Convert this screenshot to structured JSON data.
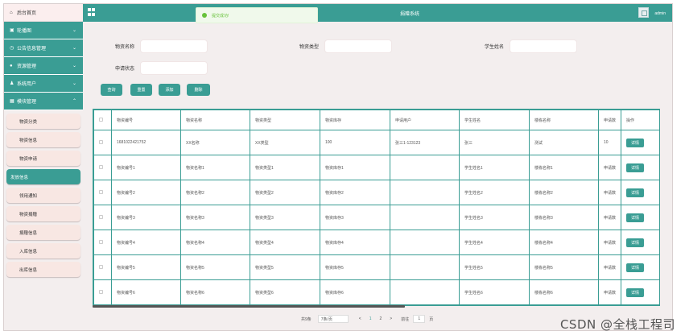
{
  "sidebar": {
    "home": "后台首页",
    "menus": [
      {
        "label": "轮播图",
        "icon": "image-icon",
        "glyph": "▣"
      },
      {
        "label": "公告信息管理",
        "icon": "clock-icon",
        "glyph": "◷"
      },
      {
        "label": "资源管理",
        "icon": "drop-icon",
        "glyph": "●"
      },
      {
        "label": "系统用户",
        "icon": "user-icon",
        "glyph": "♟"
      },
      {
        "label": "模块管理",
        "icon": "grid-icon",
        "glyph": "▦"
      }
    ],
    "submenu": [
      "物资分类",
      "物资信息",
      "物资申请",
      "发放信息",
      "领用通知",
      "物资捐赠",
      "捐赠信息",
      "入库信息",
      "出库信息"
    ],
    "active_submenu": "发放信息"
  },
  "topbar": {
    "title": "捐赠系统",
    "user": "admin"
  },
  "toast": "提交成功!",
  "search": {
    "name_label": "物资名称",
    "type_label": "物资类型",
    "student_label": "学生姓名",
    "status_label": "申请状态"
  },
  "buttons": {
    "query": "查询",
    "reset": "重置",
    "add": "添加",
    "delete": "删除"
  },
  "table": {
    "columns": [
      "物资编号",
      "物资名称",
      "物资类型",
      "物资库存",
      "申请用户",
      "学生姓名",
      "楼栋名称",
      "申请数",
      "操作"
    ],
    "rows": [
      [
        "1681022421752",
        "XX名称",
        "XX类型",
        "100",
        "张三1-123123",
        "张三",
        "测试",
        "10"
      ],
      [
        "物资编号1",
        "物资名称1",
        "物资类型1",
        "物资库存1",
        "",
        "学生姓名1",
        "楼栋名称1",
        "申请数"
      ],
      [
        "物资编号2",
        "物资名称2",
        "物资类型2",
        "物资库存2",
        "",
        "学生姓名2",
        "楼栋名称2",
        "申请数"
      ],
      [
        "物资编号3",
        "物资名称3",
        "物资类型3",
        "物资库存3",
        "",
        "学生姓名3",
        "楼栋名称3",
        "申请数"
      ],
      [
        "物资编号4",
        "物资名称4",
        "物资类型4",
        "物资库存4",
        "",
        "学生姓名4",
        "楼栋名称4",
        "申请数"
      ],
      [
        "物资编号5",
        "物资名称5",
        "物资类型5",
        "物资库存5",
        "",
        "学生姓名5",
        "楼栋名称5",
        "申请数"
      ],
      [
        "物资编号6",
        "物资名称6",
        "物资类型6",
        "物资库存6",
        "",
        "学生姓名6",
        "楼栋名称6",
        "申请数"
      ]
    ],
    "detail_label": "详情"
  },
  "pagination": {
    "total": "共9条",
    "page_size": "7条/页",
    "prev": "<",
    "pages": [
      "1",
      "2"
    ],
    "next": ">",
    "goto": "前往",
    "goto_value": "1",
    "page_unit": "页"
  },
  "watermark": "CSDN @全栈工程司",
  "colors": {
    "accent": "#3a9d94",
    "background": "#f3eeee",
    "success": "#67c23a"
  }
}
